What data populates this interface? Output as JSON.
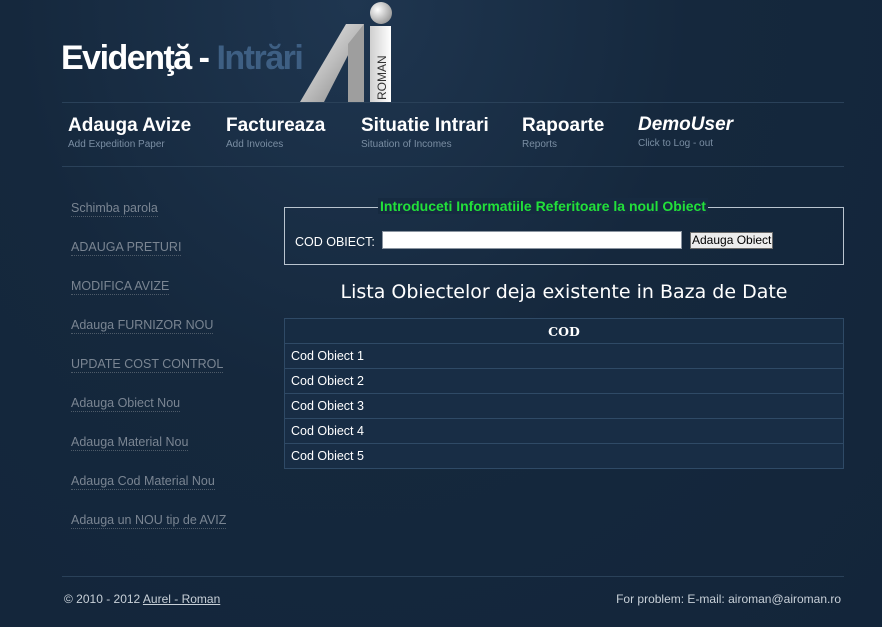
{
  "header": {
    "title_part1": "Evidenţă - ",
    "title_part2": "Intrări",
    "logo_text": "ROMAN"
  },
  "nav": [
    {
      "label": "Adauga Avize",
      "sub": "Add Expedition Paper"
    },
    {
      "label": "Factureaza",
      "sub": "Add Invoices"
    },
    {
      "label": "Situatie Intrari",
      "sub": "Situation of Incomes"
    },
    {
      "label": "Rapoarte",
      "sub": "Reports"
    },
    {
      "label": "DemoUser",
      "sub": "Click to Log - out"
    }
  ],
  "sidebar": [
    {
      "label": "Schimba parola"
    },
    {
      "label": "ADAUGA PRETURI"
    },
    {
      "label": "MODIFICA AVIZE"
    },
    {
      "label": "Adauga FURNIZOR NOU"
    },
    {
      "label": "UPDATE COST CONTROL"
    },
    {
      "label": "Adauga Obiect Nou"
    },
    {
      "label": "Adauga Material Nou"
    },
    {
      "label": "Adauga Cod Material Nou"
    },
    {
      "label": "Adauga un NOU tip de AVIZ"
    }
  ],
  "form": {
    "legend": "Introduceti Informatiile Referitoare la noul Obiect",
    "label": "COD OBIECT:",
    "value": "",
    "button": "Adauga Obiect"
  },
  "list": {
    "heading": "Lista Obiectelor deja existente in Baza de Date",
    "column": "COD",
    "rows": [
      "Cod Obiect 1",
      "Cod Obiect 2",
      "Cod Obiect 3",
      "Cod Obiect 4",
      "Cod Obiect 5"
    ]
  },
  "footer": {
    "copyright": "© 2010 - 2012 ",
    "author_link": "Aurel - Roman",
    "contact": "For problem: E-mail: airoman@airoman.ro"
  },
  "colors": {
    "background": "#15283d",
    "title_accent": "#3e5f83",
    "legend_green": "#22e03a",
    "sidebar_link": "#7a8592"
  }
}
